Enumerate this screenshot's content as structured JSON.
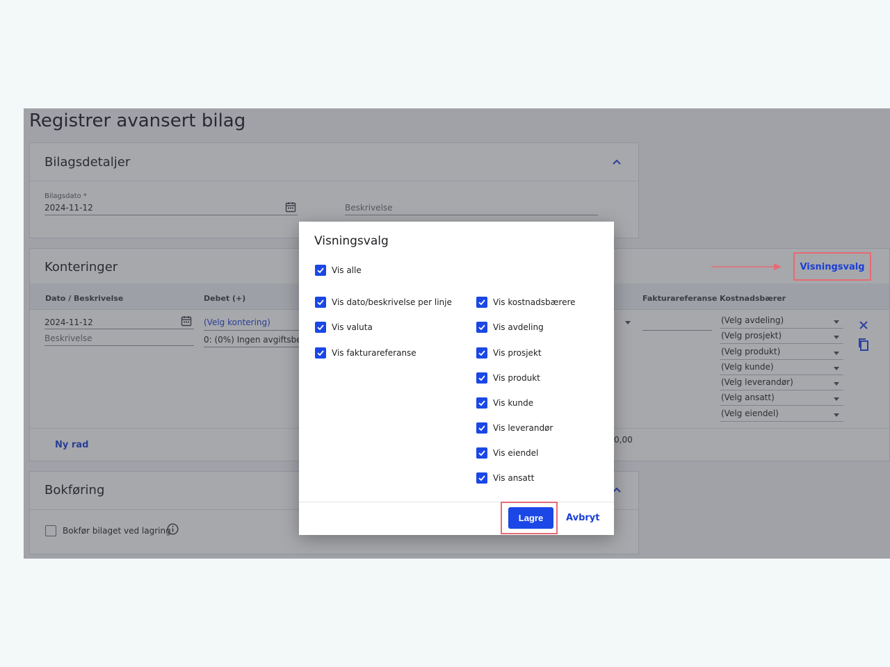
{
  "page": {
    "title": "Registrer avansert bilag"
  },
  "bilagsdetaljer": {
    "title": "Bilagsdetaljer",
    "date_label": "Bilagsdato *",
    "date_value": "2024-11-12",
    "description_placeholder": "Beskrivelse"
  },
  "konteringer": {
    "title": "Konteringer",
    "visningsvalg_label": "Visningsvalg",
    "columns": {
      "dato": "Dato / Beskrivelse",
      "debet": "Debet (+)",
      "fakturareferanse": "Fakturareferanse",
      "kostnadsbaerer": "Kostnadsbærer"
    },
    "row": {
      "date": "2024-11-12",
      "description_placeholder": "Beskrivelse",
      "kontering": "(Velg kontering)",
      "mva": "0: (0%) Ingen avgiftsbe",
      "cost_carriers": [
        "(Velg avdeling)",
        "(Velg prosjekt)",
        "(Velg produkt)",
        "(Velg kunde)",
        "(Velg leverandør)",
        "(Velg ansatt)",
        "(Velg eiendel)"
      ]
    },
    "new_row_label": "Ny rad",
    "total": "0,00"
  },
  "bokforing": {
    "title": "Bokføring",
    "checkbox_label": "Bokfør bilaget ved lagring"
  },
  "dialog": {
    "title": "Visningsvalg",
    "vis_alle": "Vis alle",
    "left_options": [
      "Vis dato/beskrivelse per linje",
      "Vis valuta",
      "Vis fakturareferanse"
    ],
    "right_options": [
      "Vis kostnadsbærere",
      "Vis avdeling",
      "Vis prosjekt",
      "Vis produkt",
      "Vis kunde",
      "Vis leverandør",
      "Vis eiendel",
      "Vis ansatt"
    ],
    "save_label": "Lagre",
    "cancel_label": "Avbryt"
  },
  "colors": {
    "accent": "#1a47e6",
    "highlight": "#e66a75",
    "overlay": "rgba(60,62,70,0.45)"
  }
}
